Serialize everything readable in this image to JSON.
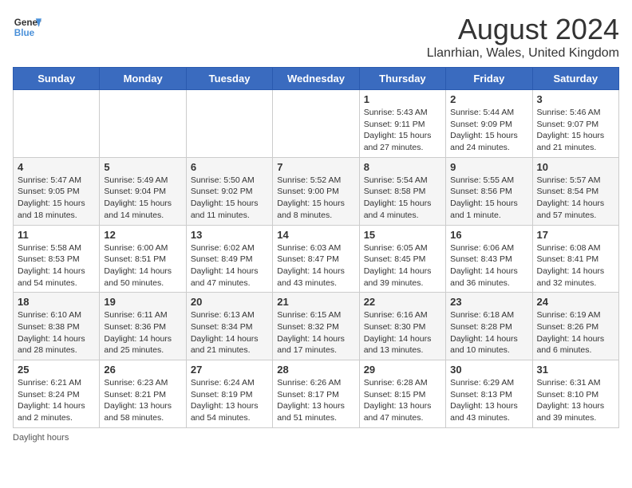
{
  "header": {
    "logo_line1": "General",
    "logo_line2": "Blue",
    "main_title": "August 2024",
    "subtitle": "Llanrhian, Wales, United Kingdom"
  },
  "days_of_week": [
    "Sunday",
    "Monday",
    "Tuesday",
    "Wednesday",
    "Thursday",
    "Friday",
    "Saturday"
  ],
  "weeks": [
    [
      {
        "num": "",
        "info": ""
      },
      {
        "num": "",
        "info": ""
      },
      {
        "num": "",
        "info": ""
      },
      {
        "num": "",
        "info": ""
      },
      {
        "num": "1",
        "info": "Sunrise: 5:43 AM\nSunset: 9:11 PM\nDaylight: 15 hours\nand 27 minutes."
      },
      {
        "num": "2",
        "info": "Sunrise: 5:44 AM\nSunset: 9:09 PM\nDaylight: 15 hours\nand 24 minutes."
      },
      {
        "num": "3",
        "info": "Sunrise: 5:46 AM\nSunset: 9:07 PM\nDaylight: 15 hours\nand 21 minutes."
      }
    ],
    [
      {
        "num": "4",
        "info": "Sunrise: 5:47 AM\nSunset: 9:05 PM\nDaylight: 15 hours\nand 18 minutes."
      },
      {
        "num": "5",
        "info": "Sunrise: 5:49 AM\nSunset: 9:04 PM\nDaylight: 15 hours\nand 14 minutes."
      },
      {
        "num": "6",
        "info": "Sunrise: 5:50 AM\nSunset: 9:02 PM\nDaylight: 15 hours\nand 11 minutes."
      },
      {
        "num": "7",
        "info": "Sunrise: 5:52 AM\nSunset: 9:00 PM\nDaylight: 15 hours\nand 8 minutes."
      },
      {
        "num": "8",
        "info": "Sunrise: 5:54 AM\nSunset: 8:58 PM\nDaylight: 15 hours\nand 4 minutes."
      },
      {
        "num": "9",
        "info": "Sunrise: 5:55 AM\nSunset: 8:56 PM\nDaylight: 15 hours\nand 1 minute."
      },
      {
        "num": "10",
        "info": "Sunrise: 5:57 AM\nSunset: 8:54 PM\nDaylight: 14 hours\nand 57 minutes."
      }
    ],
    [
      {
        "num": "11",
        "info": "Sunrise: 5:58 AM\nSunset: 8:53 PM\nDaylight: 14 hours\nand 54 minutes."
      },
      {
        "num": "12",
        "info": "Sunrise: 6:00 AM\nSunset: 8:51 PM\nDaylight: 14 hours\nand 50 minutes."
      },
      {
        "num": "13",
        "info": "Sunrise: 6:02 AM\nSunset: 8:49 PM\nDaylight: 14 hours\nand 47 minutes."
      },
      {
        "num": "14",
        "info": "Sunrise: 6:03 AM\nSunset: 8:47 PM\nDaylight: 14 hours\nand 43 minutes."
      },
      {
        "num": "15",
        "info": "Sunrise: 6:05 AM\nSunset: 8:45 PM\nDaylight: 14 hours\nand 39 minutes."
      },
      {
        "num": "16",
        "info": "Sunrise: 6:06 AM\nSunset: 8:43 PM\nDaylight: 14 hours\nand 36 minutes."
      },
      {
        "num": "17",
        "info": "Sunrise: 6:08 AM\nSunset: 8:41 PM\nDaylight: 14 hours\nand 32 minutes."
      }
    ],
    [
      {
        "num": "18",
        "info": "Sunrise: 6:10 AM\nSunset: 8:38 PM\nDaylight: 14 hours\nand 28 minutes."
      },
      {
        "num": "19",
        "info": "Sunrise: 6:11 AM\nSunset: 8:36 PM\nDaylight: 14 hours\nand 25 minutes."
      },
      {
        "num": "20",
        "info": "Sunrise: 6:13 AM\nSunset: 8:34 PM\nDaylight: 14 hours\nand 21 minutes."
      },
      {
        "num": "21",
        "info": "Sunrise: 6:15 AM\nSunset: 8:32 PM\nDaylight: 14 hours\nand 17 minutes."
      },
      {
        "num": "22",
        "info": "Sunrise: 6:16 AM\nSunset: 8:30 PM\nDaylight: 14 hours\nand 13 minutes."
      },
      {
        "num": "23",
        "info": "Sunrise: 6:18 AM\nSunset: 8:28 PM\nDaylight: 14 hours\nand 10 minutes."
      },
      {
        "num": "24",
        "info": "Sunrise: 6:19 AM\nSunset: 8:26 PM\nDaylight: 14 hours\nand 6 minutes."
      }
    ],
    [
      {
        "num": "25",
        "info": "Sunrise: 6:21 AM\nSunset: 8:24 PM\nDaylight: 14 hours\nand 2 minutes."
      },
      {
        "num": "26",
        "info": "Sunrise: 6:23 AM\nSunset: 8:21 PM\nDaylight: 13 hours\nand 58 minutes."
      },
      {
        "num": "27",
        "info": "Sunrise: 6:24 AM\nSunset: 8:19 PM\nDaylight: 13 hours\nand 54 minutes."
      },
      {
        "num": "28",
        "info": "Sunrise: 6:26 AM\nSunset: 8:17 PM\nDaylight: 13 hours\nand 51 minutes."
      },
      {
        "num": "29",
        "info": "Sunrise: 6:28 AM\nSunset: 8:15 PM\nDaylight: 13 hours\nand 47 minutes."
      },
      {
        "num": "30",
        "info": "Sunrise: 6:29 AM\nSunset: 8:13 PM\nDaylight: 13 hours\nand 43 minutes."
      },
      {
        "num": "31",
        "info": "Sunrise: 6:31 AM\nSunset: 8:10 PM\nDaylight: 13 hours\nand 39 minutes."
      }
    ]
  ],
  "footer": {
    "note": "Daylight hours"
  }
}
